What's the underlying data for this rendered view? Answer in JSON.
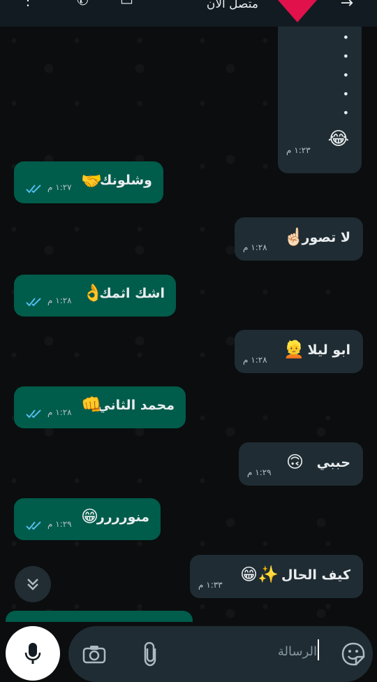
{
  "header": {
    "status": "متصل الآن"
  },
  "messages": [
    {
      "dir": "in",
      "text": "",
      "emoji": "😂",
      "time": "١:٢٣ م"
    },
    {
      "dir": "out",
      "text": "وشلونك",
      "emoji": "🤝",
      "time": "١:٢٧ م"
    },
    {
      "dir": "in",
      "text": "لا تصور",
      "emoji": "☝🏻",
      "time": "١:٢٨ م"
    },
    {
      "dir": "out",
      "text": "اشك اثمك",
      "emoji": "👌",
      "time": "١:٢٨ م"
    },
    {
      "dir": "in",
      "text": "ابو ليلا",
      "emoji": "👱",
      "time": "١:٢٨ م"
    },
    {
      "dir": "out",
      "text": "محمد الثاني",
      "emoji": "👊",
      "time": "١:٢٨ م"
    },
    {
      "dir": "in",
      "text": "حببي",
      "emoji": "🙃",
      "time": "١:٢٩ م"
    },
    {
      "dir": "out",
      "text": "منورررر",
      "emoji": "😁",
      "time": "١:٢٩ م"
    },
    {
      "dir": "in",
      "text": "كيف الحال",
      "emoji": "😁✨",
      "time": "١:٣٣ م"
    }
  ],
  "composer": {
    "placeholder": "الرسالة"
  },
  "colors": {
    "incoming_bubble": "#1f2c33",
    "outgoing_bubble": "#005c4b",
    "read_ticks": "#53bdeb"
  }
}
